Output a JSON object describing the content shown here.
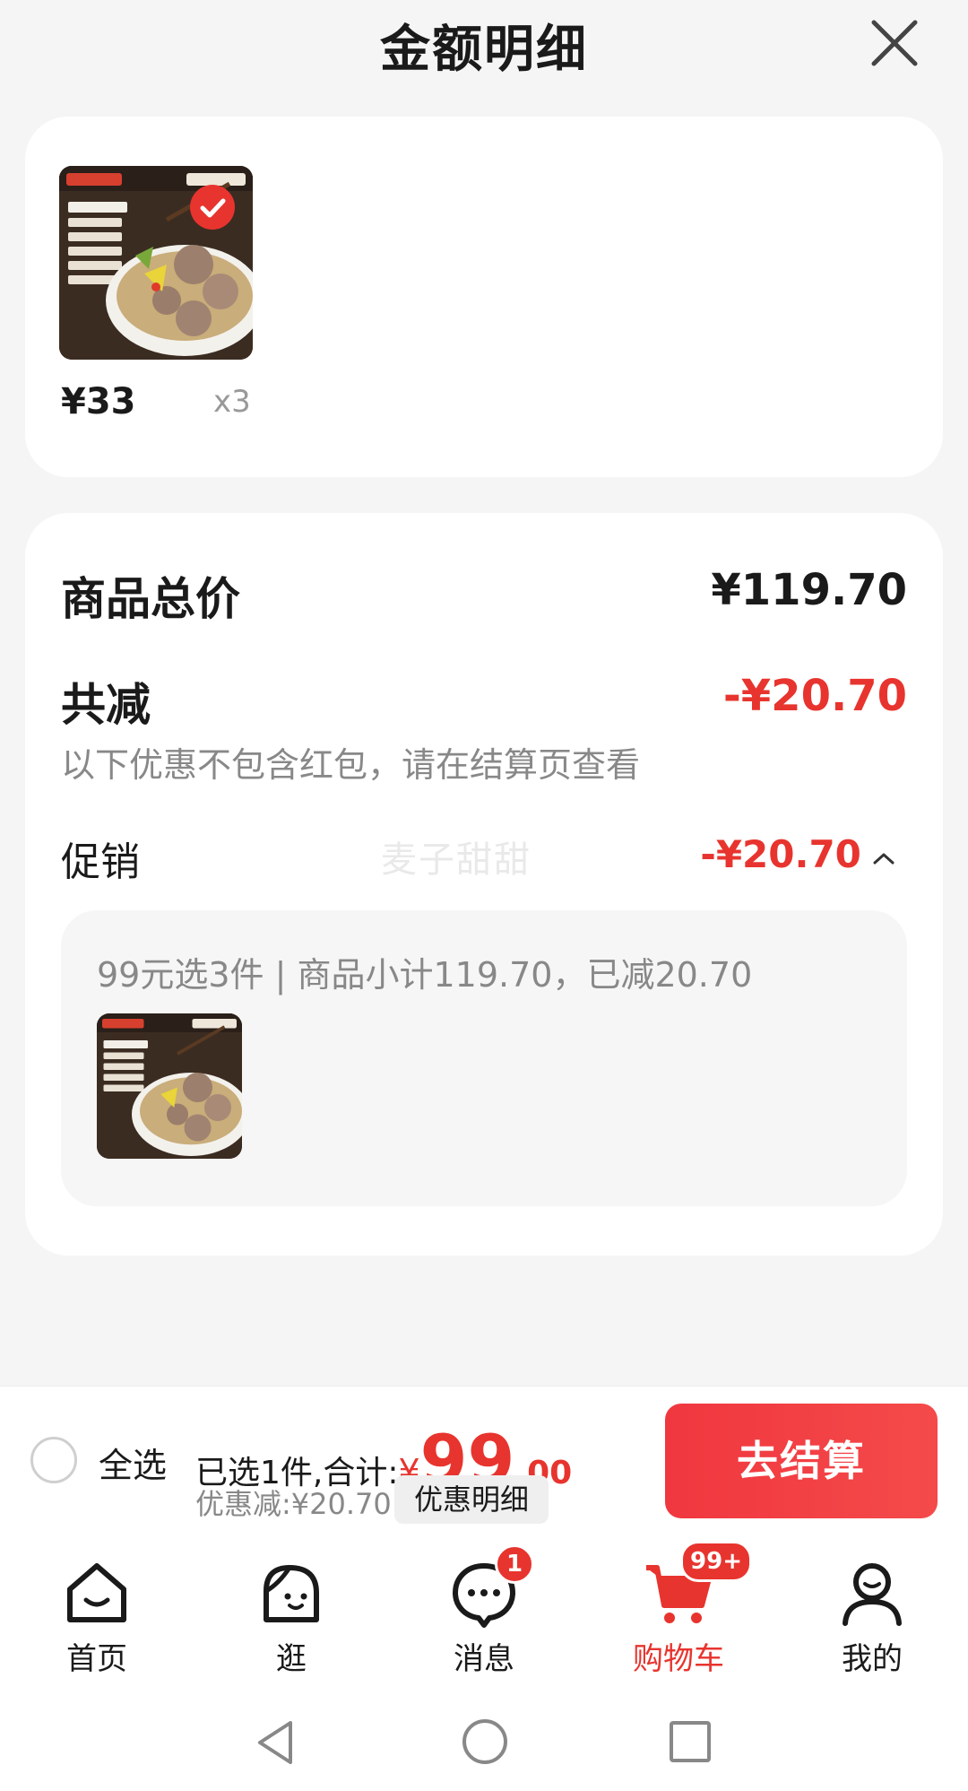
{
  "header": {
    "title": "金额明细",
    "close_icon": "close-icon"
  },
  "product": {
    "price": "¥33",
    "quantity": "x3",
    "selected": true
  },
  "summary": {
    "total_label": "商品总价",
    "total_value": "¥119.70",
    "reduction_label": "共减",
    "reduction_value": "-¥20.70",
    "note": "以下优惠不包含红包，请在结算页查看",
    "promo_label": "促销",
    "promo_value": "-¥20.70",
    "watermark": "麦子甜甜"
  },
  "promo_detail": {
    "text": "99元选3件 | 商品小计119.70，已减20.70"
  },
  "checkout_bar": {
    "select_all_label": "全选",
    "selected_summary": "已选1件,合计:",
    "currency": "¥",
    "total_integer": "99",
    "total_decimal": ".00",
    "discount_text": "优惠减:¥20.70",
    "discount_detail_button": "优惠明细",
    "checkout_button": "去结算"
  },
  "tabbar": {
    "items": [
      {
        "label": "首页",
        "icon": "home-icon"
      },
      {
        "label": "逛",
        "icon": "browse-icon"
      },
      {
        "label": "消息",
        "icon": "message-icon",
        "badge": "1"
      },
      {
        "label": "购物车",
        "icon": "cart-icon",
        "badge": "99+",
        "active": true
      },
      {
        "label": "我的",
        "icon": "profile-icon"
      }
    ]
  },
  "colors": {
    "accent": "#e8342e",
    "background": "#f5f5f5"
  }
}
